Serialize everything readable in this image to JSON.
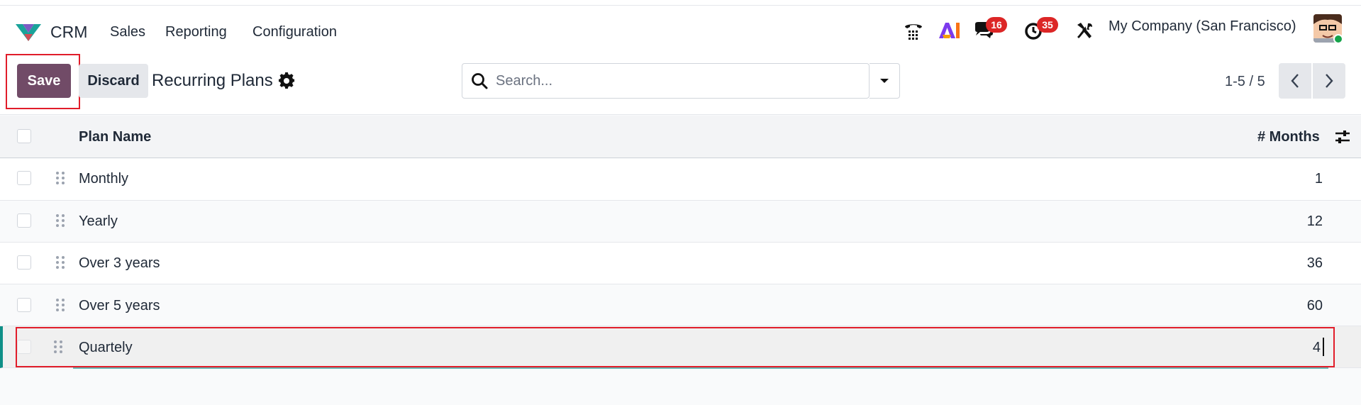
{
  "app": {
    "name": "CRM",
    "menu": [
      "Sales",
      "Reporting",
      "Configuration"
    ]
  },
  "systray": {
    "phone_icon": "phone-icon",
    "ai_label": "AI",
    "discuss_count": "16",
    "activity_count": "35",
    "tools_icon": "tools-icon",
    "company": "My Company (San Francisco)"
  },
  "controls": {
    "save_label": "Save",
    "discard_label": "Discard",
    "title": "Recurring Plans",
    "search_placeholder": "Search...",
    "pager": "1-5 / 5"
  },
  "table": {
    "columns": [
      "Plan Name",
      "# Months"
    ],
    "rows": [
      {
        "name": "Monthly",
        "months": "1"
      },
      {
        "name": "Yearly",
        "months": "12"
      },
      {
        "name": "Over 3 years",
        "months": "36"
      },
      {
        "name": "Over 5 years",
        "months": "60"
      },
      {
        "name": "Quartely",
        "months": "4"
      }
    ]
  },
  "colors": {
    "brand": "#714b67",
    "highlight": "#e11d2a",
    "badge": "#dc2626",
    "edit_accent": "#0e8f87"
  }
}
